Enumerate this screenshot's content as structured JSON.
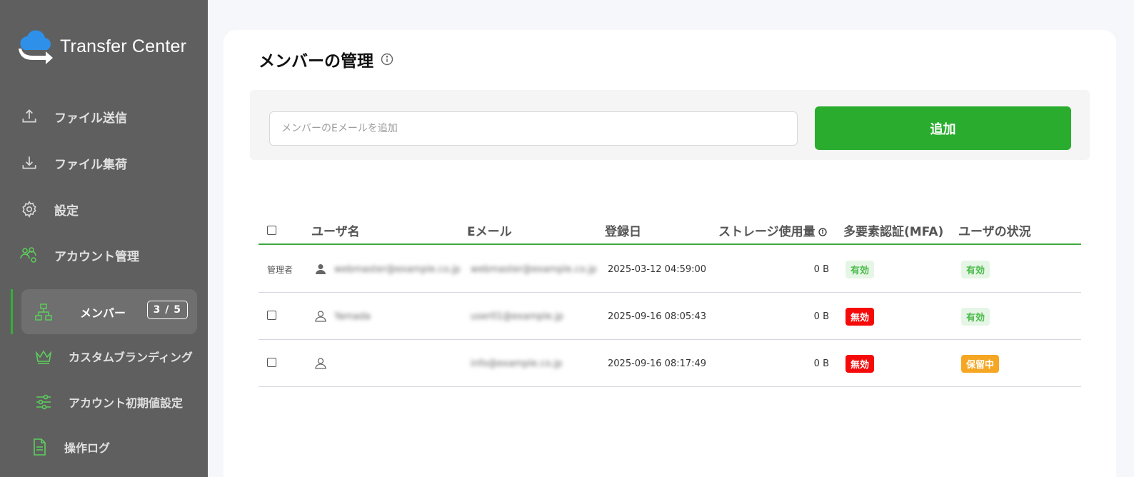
{
  "app": {
    "logo_text": "Transfer Center"
  },
  "sidebar": {
    "items": [
      {
        "label": "ファイル送信",
        "icon": "upload-icon"
      },
      {
        "label": "ファイル集荷",
        "icon": "download-icon"
      },
      {
        "label": "設定",
        "icon": "gear-icon"
      },
      {
        "label": "アカウント管理",
        "icon": "users-gear-icon"
      }
    ],
    "sub_items": [
      {
        "label": "メンバー",
        "icon": "org-chart-icon",
        "badge": "3 / 5"
      },
      {
        "label": "カスタムブランディング",
        "icon": "crown-icon"
      },
      {
        "label": "アカウント初期値設定",
        "icon": "sliders-icon"
      },
      {
        "label": "操作ログ",
        "icon": "document-icon"
      }
    ]
  },
  "main": {
    "title": "メンバーの管理",
    "email_placeholder": "メンバーのEメールを追加",
    "add_label": "追加",
    "columns": [
      "ユーザ名",
      "Eメール",
      "登録日",
      "ストレージ使用量",
      "多要素認証(MFA)",
      "ユーザの状況"
    ],
    "rows": [
      {
        "role": "管理者",
        "name": "webmaster@example.co.jp",
        "email": "webmaster@example.co.jp",
        "date": "2025-03-12 04:59:00",
        "storage": "0 B",
        "mfa": "有効",
        "status": "有効"
      },
      {
        "role": "",
        "name": "Yamada",
        "email": "user01@example.jp",
        "date": "2025-09-16 08:05:43",
        "storage": "0 B",
        "mfa": "無効",
        "status": "有効"
      },
      {
        "role": "",
        "name": "",
        "email": "info@example.co.jp",
        "date": "2025-09-16 08:17:49",
        "storage": "0 B",
        "mfa": "無効",
        "status": "保留中"
      }
    ]
  },
  "colors": {
    "accent": "#2aad2e",
    "sidebar": "#5f5f5f",
    "danger": "#f50a0a",
    "warning": "#f5a623"
  }
}
